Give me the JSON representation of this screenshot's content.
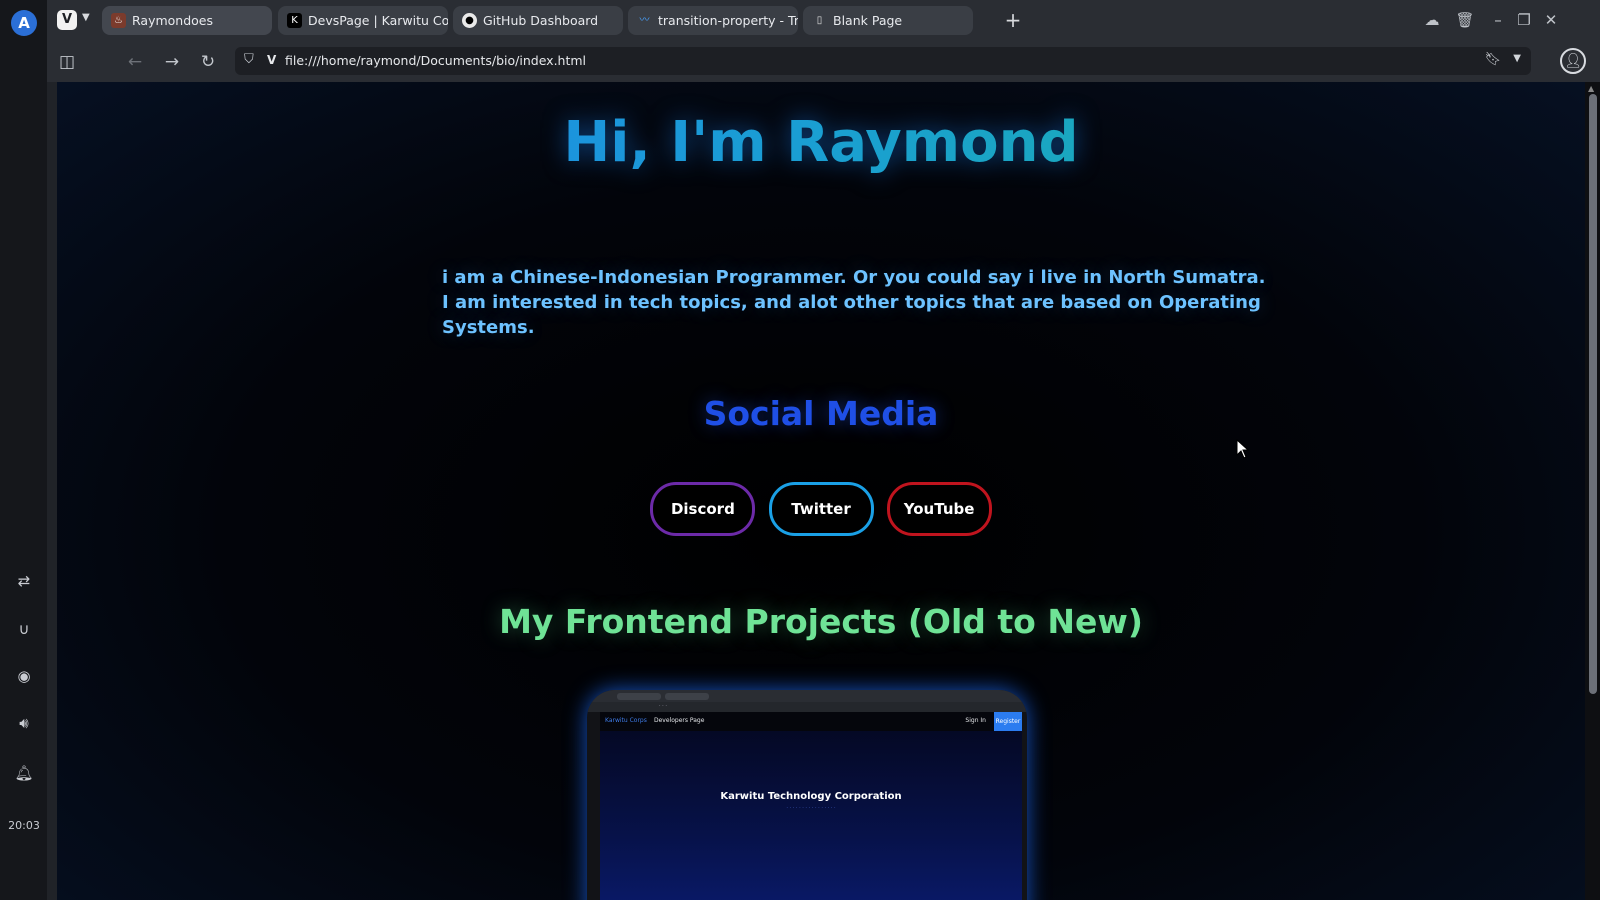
{
  "os_panel": {
    "launcher_label": "A",
    "clock": "20:03",
    "icons": [
      "share-icon",
      "magnet-icon",
      "discord-icon",
      "volume-icon",
      "bell-icon"
    ]
  },
  "tabs": [
    {
      "label": "Raymondoes",
      "active": true
    },
    {
      "label": "DevsPage | Karwitu Corps",
      "active": false
    },
    {
      "label": "GitHub Dashboard",
      "active": false
    },
    {
      "label": "transition-property - Tra...",
      "active": false
    },
    {
      "label": "Blank Page",
      "active": false
    }
  ],
  "new_tab_label": "+",
  "address": {
    "url": "file:///home/raymond/Documents/bio/index.html",
    "identity_badge": "V"
  },
  "page": {
    "hero": "Hi, I'm Raymond",
    "bio_line1": "i am a Chinese-Indonesian Programmer. Or you could say i live in North Sumatra.",
    "bio_line2": "I am interested in tech topics, and alot other topics that are based on Operating Systems.",
    "social_title": "Social Media",
    "social_buttons": [
      {
        "label": "Discord",
        "border": "#6c2aa8"
      },
      {
        "label": "Twitter",
        "border": "#1aa0e6"
      },
      {
        "label": "YouTube",
        "border": "#c0141e"
      }
    ],
    "projects_title": "My Frontend Projects (Old to New)"
  },
  "preview": {
    "brand": "Karwitu Corps",
    "brand_sub": "Developers Page",
    "sign_in": "Sign In",
    "register": "Register",
    "headline": "Karwitu Technology Corporation"
  },
  "colors": {
    "hero_gradient_start": "#1e7ff0",
    "hero_gradient_end": "#19b59a",
    "bio": "#6dc2ff",
    "social_title": "#1f4fe6",
    "projects_title": "#6fe396"
  }
}
